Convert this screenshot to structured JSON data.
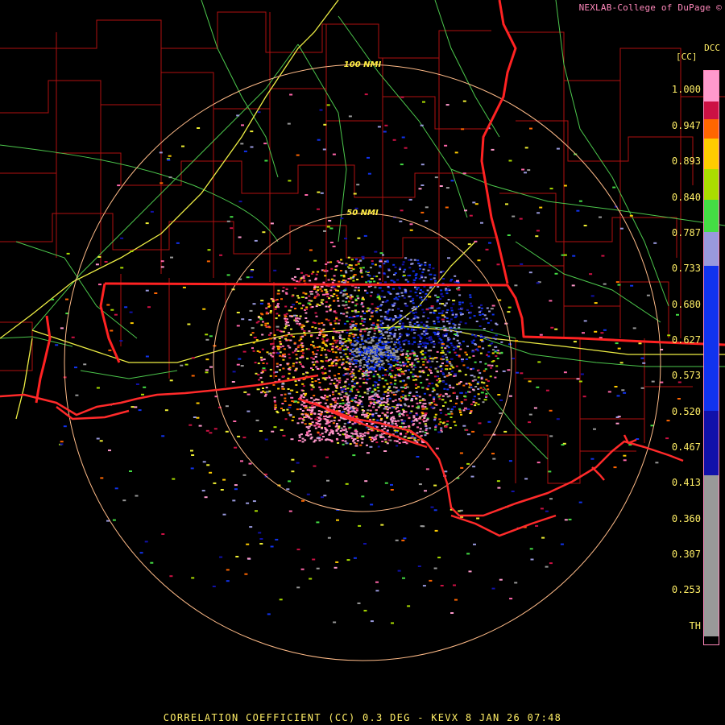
{
  "header": {
    "credit": "NEXLAB-College of DuPage",
    "credit_icon": "cod-logo-icon",
    "product_code": "DCC",
    "unit_label": "[CC]"
  },
  "map": {
    "range_ring_labels": [
      "100 NMI",
      "50 NMI"
    ],
    "colors": {
      "state_border": "#ff2222",
      "county_border": "#cc1111",
      "highway": "#55dd55",
      "interstate": "#eeee44",
      "range_ring": "#ffbb88"
    }
  },
  "colorbar": {
    "ticks": [
      "1.000",
      "0.947",
      "0.893",
      "0.840",
      "0.787",
      "0.733",
      "0.680",
      "0.627",
      "0.573",
      "0.520",
      "0.467",
      "0.413",
      "0.360",
      "0.307",
      "0.253",
      "TH"
    ],
    "colors": [
      "#ff99cc",
      "#cc1144",
      "#ff6600",
      "#ffcc00",
      "#aadd00",
      "#44dd44",
      "#9999dd",
      "#1133ee",
      "#1111aa",
      "#999999",
      "#000000"
    ]
  },
  "caption": "CORRELATION COEFFICIENT (CC) 0.3 DEG - KEVX 8 JAN 26 07:48"
}
